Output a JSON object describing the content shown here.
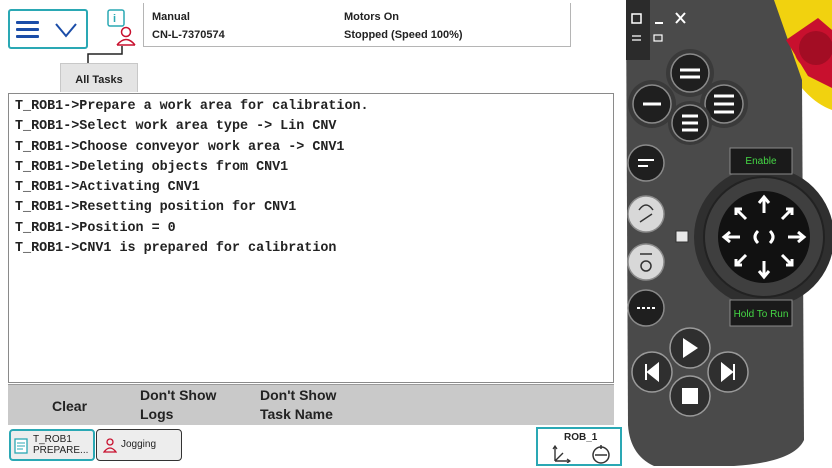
{
  "header": {
    "mode": "Manual",
    "controller": "CN-L-7370574",
    "motors": "Motors On",
    "run_state": "Stopped (Speed 100%)",
    "tab_label": "All Tasks"
  },
  "log_lines": [
    "T_ROB1->Prepare a work area for calibration.",
    "T_ROB1->Select work area type -> Lin CNV",
    "T_ROB1->Choose conveyor work area -> CNV1",
    "T_ROB1->Deleting objects from CNV1",
    "T_ROB1->Activating CNV1",
    "T_ROB1->Resetting position for CNV1",
    "T_ROB1->Position = 0",
    "T_ROB1->CNV1 is prepared for calibration"
  ],
  "commands": {
    "clear": "Clear",
    "hide_logs": [
      "Don't Show",
      "Logs"
    ],
    "hide_task_name": [
      "Don't Show",
      "Task Name"
    ]
  },
  "taskbar": {
    "task_button": [
      "T_ROB1",
      "PREPARE..."
    ],
    "jogging_button": "Jogging",
    "mech_unit": "ROB_1"
  },
  "pendant": {
    "enable_label": "Enable",
    "hold_label": "Hold To Run"
  },
  "colors": {
    "accent": "#2aa8b4",
    "menu_icon": "#1b4da8",
    "pendant_body": "#4a4a4a",
    "pendant_yellow": "#f1d20f",
    "stop_red": "#c8102e",
    "indicator_green": "#45d845"
  },
  "icons": [
    "menu-hamburger-icon",
    "chevron-down-icon",
    "tasks-info-icon",
    "robot-status-icon",
    "task-icon",
    "jogging-person-icon",
    "coordinate-system-icon",
    "no-tool-icon"
  ]
}
